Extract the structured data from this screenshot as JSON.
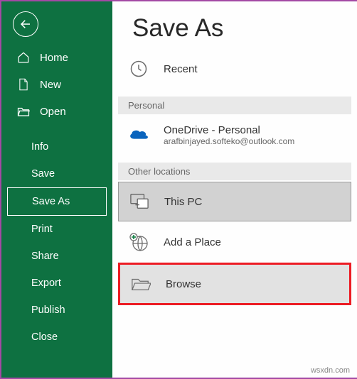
{
  "sidebar": {
    "home": "Home",
    "new": "New",
    "open": "Open",
    "info": "Info",
    "save": "Save",
    "save_as": "Save As",
    "print": "Print",
    "share": "Share",
    "export": "Export",
    "publish": "Publish",
    "close": "Close"
  },
  "main": {
    "title": "Save As",
    "recent": "Recent",
    "section_personal": "Personal",
    "onedrive_name": "OneDrive - Personal",
    "onedrive_email": "arafbinjayed.softeko@outlook.com",
    "section_other": "Other locations",
    "thispc": "This PC",
    "addplace": "Add a Place",
    "browse": "Browse"
  },
  "watermark": "wsxdn.com"
}
